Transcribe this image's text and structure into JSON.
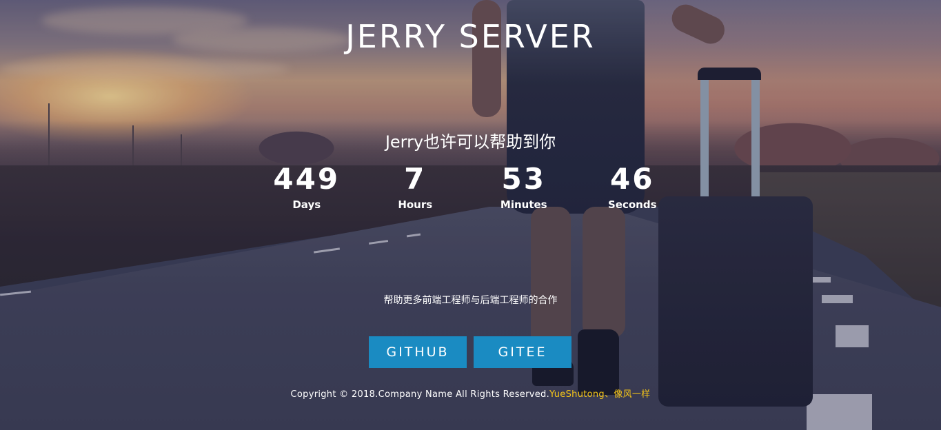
{
  "site": {
    "title": "JERRY SERVER",
    "tagline": "Jerry也许可以帮助到你",
    "subtitle": "帮助更多前端工程师与后端工程师的合作"
  },
  "countdown": {
    "days": {
      "value": "449",
      "label": "Days"
    },
    "hours": {
      "value": "7",
      "label": "Hours"
    },
    "minutes": {
      "value": "53",
      "label": "Minutes"
    },
    "seconds": {
      "value": "46",
      "label": "Seconds"
    }
  },
  "buttons": {
    "github_label": "GITHUB",
    "gitee_label": "GITEE"
  },
  "footer": {
    "copyright": "Copyright © 2018.Company Name All Rights Reserved.",
    "link_text": "YueShutong、像风一样"
  },
  "colors": {
    "button_bg": "#1a8bc2",
    "footer_link": "#f5c518",
    "text": "#ffffff"
  }
}
